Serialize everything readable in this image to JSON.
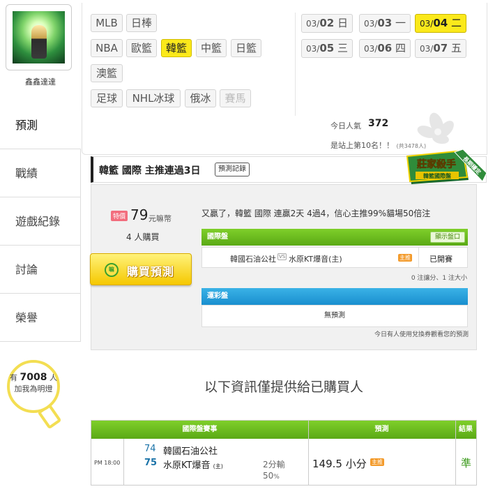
{
  "user": {
    "name": "鑫鑫達達"
  },
  "sidebar": {
    "items": [
      {
        "label": "預測"
      },
      {
        "label": "戰績"
      },
      {
        "label": "遊戲紀錄"
      },
      {
        "label": "討論"
      },
      {
        "label": "榮譽"
      }
    ],
    "bulb": {
      "prefix": "有",
      "count": "7008",
      "suffix": "人",
      "line2": "加我為明燈"
    }
  },
  "filters": {
    "sports": [
      "MLB",
      "日棒",
      "NBA",
      "歐籃",
      "韓籃",
      "中籃",
      "日籃",
      "澳籃",
      "足球",
      "NHL冰球",
      "俄冰",
      "賽馬"
    ],
    "selected": "韓籃",
    "dates": [
      {
        "md_a": "03/",
        "md_b": "02",
        "wd": "日"
      },
      {
        "md_a": "03/",
        "md_b": "03",
        "wd": "一"
      },
      {
        "md_a": "03/",
        "md_b": "04",
        "wd": "二"
      },
      {
        "md_a": "03/",
        "md_b": "05",
        "wd": "三"
      },
      {
        "md_a": "03/",
        "md_b": "06",
        "wd": "四"
      },
      {
        "md_a": "03/",
        "md_b": "07",
        "wd": "五"
      }
    ],
    "selected_date": "03/04"
  },
  "stats": {
    "popularity_label": "今日人氣",
    "popularity_value": "372",
    "rank_text": "是站上第10名！！",
    "rank_total": "(共3478人)"
  },
  "prediction": {
    "streak_title": "韓籃 國際 主推連過3日",
    "record_button": "預測記錄",
    "badge_line1": "莊家殺手",
    "badge_line2": "韓籃國際盤",
    "badge_ribbon": "長期穩定",
    "price_tag": "特價",
    "price": "79",
    "price_unit": "元嘛幣",
    "buyers": "4 人購買",
    "buy_button": "購買預測",
    "buy_icon": "嘛",
    "summary": "又贏了，韓籃 國際 連贏2天 4過4，信心主推99%貓場50倍注",
    "intl_header": "國際盤",
    "show_odds": "顯示盤口",
    "match": {
      "home": "韓國石油公社",
      "vs": "VS",
      "away": "水原KT爆音(主)",
      "zhu": "主推",
      "status": "已開賽"
    },
    "note1": "0 注讓分、1 注大小",
    "lottery_header": "運彩盤",
    "lottery_value": "無預測",
    "note2": "今日有人使用兌換券觀看您的預測"
  },
  "info_heading": "以下資訊僅提供給已購買人",
  "results": {
    "headers": {
      "game": "國際盤賽事",
      "pred": "預測",
      "result": "結果"
    },
    "time": "PM 18:00",
    "team1": {
      "num": "74",
      "name": "韓國石油公社"
    },
    "team2": {
      "num": "75",
      "name": "水原KT爆音",
      "tag": "(主)"
    },
    "line": "2分輸",
    "pct": "50",
    "pct_unit": "%",
    "pick": "149.5 小分",
    "pick_tag": "主推",
    "result": "準"
  },
  "colors": {
    "accent_yellow": "#fbe91b",
    "green_header": "#6cbf1f",
    "blue_header": "#2aa0dc",
    "win_green": "#3a9a1a"
  }
}
